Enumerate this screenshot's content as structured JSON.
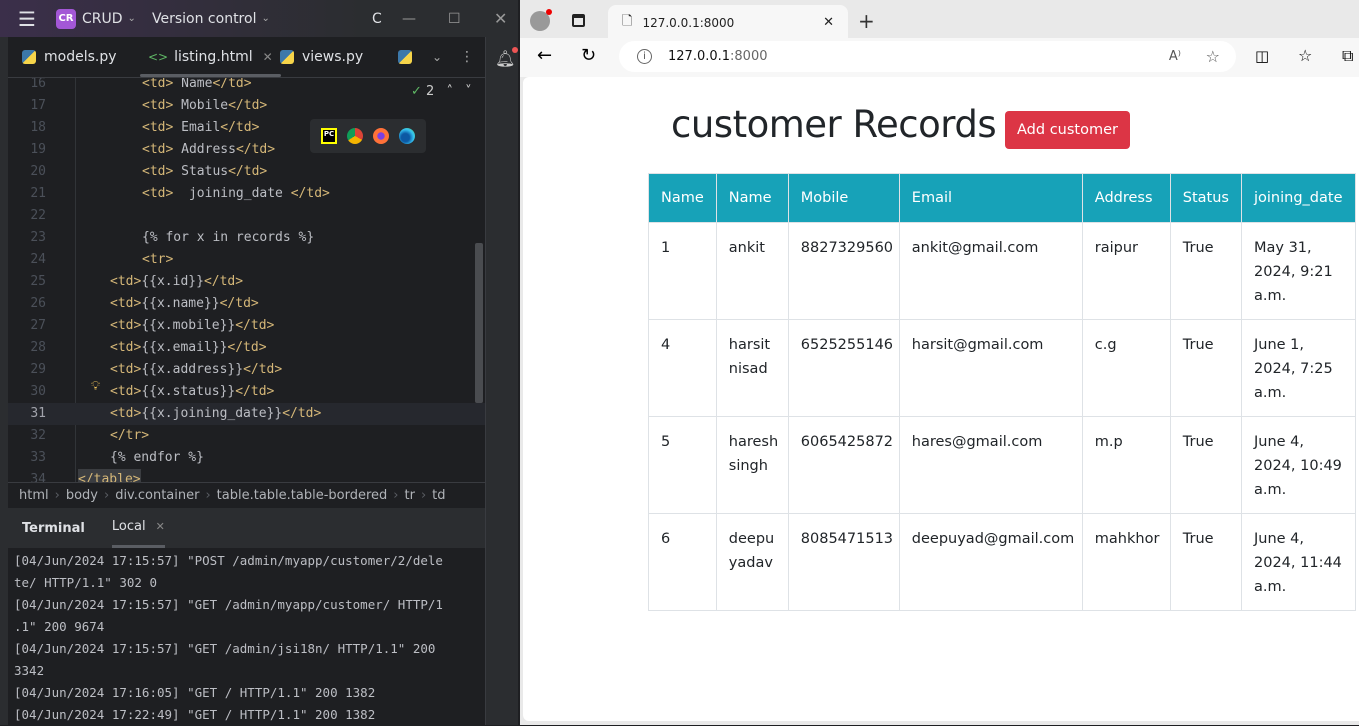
{
  "ide": {
    "project_initials": "CR",
    "project_name": "CRUD",
    "vcs_label": "Version control",
    "title_letter": "C",
    "tabs": [
      {
        "label": "models.py",
        "icon": "python-icon"
      },
      {
        "label": "listing.html",
        "icon": "html-icon",
        "active": true
      },
      {
        "label": "views.py",
        "icon": "python-icon"
      }
    ],
    "inspection_count": "2",
    "code_lines": [
      {
        "n": "16",
        "indent": 1,
        "text": "<td> Name</td>"
      },
      {
        "n": "17",
        "indent": 1,
        "text": "<td> Mobile</td>"
      },
      {
        "n": "18",
        "indent": 1,
        "text": "<td> Email</td>"
      },
      {
        "n": "19",
        "indent": 1,
        "text": "<td> Address</td>"
      },
      {
        "n": "20",
        "indent": 1,
        "text": "<td> Status</td>"
      },
      {
        "n": "21",
        "indent": 1,
        "text": "<td>  joining_date </td>"
      },
      {
        "n": "22",
        "indent": 1,
        "text": ""
      },
      {
        "n": "23",
        "indent": 1,
        "text": "{% for x in records %}"
      },
      {
        "n": "24",
        "indent": 1,
        "text": "<tr>"
      },
      {
        "n": "25",
        "indent": 0,
        "text": "<td>{{x.id}}</td>"
      },
      {
        "n": "26",
        "indent": 0,
        "text": "<td>{{x.name}}</td>"
      },
      {
        "n": "27",
        "indent": 0,
        "text": "<td>{{x.mobile}}</td>"
      },
      {
        "n": "28",
        "indent": 0,
        "text": "<td>{{x.email}}</td>"
      },
      {
        "n": "29",
        "indent": 0,
        "text": "<td>{{x.address}}</td>"
      },
      {
        "n": "30",
        "indent": 0,
        "text": "<td>{{x.status}}</td>"
      },
      {
        "n": "31",
        "indent": 0,
        "text": "<td>{{x.joining_date}}</td>",
        "current": true
      },
      {
        "n": "32",
        "indent": 0,
        "text": "</tr>"
      },
      {
        "n": "33",
        "indent": 0,
        "text": "{% endfor %}"
      },
      {
        "n": "34",
        "indent": -1,
        "text": "</table>"
      }
    ],
    "breadcrumbs": [
      "html",
      "body",
      "div.container",
      "table.table.table-bordered",
      "tr",
      "td"
    ],
    "terminal": {
      "title": "Terminal",
      "tab": "Local",
      "lines": [
        "[04/Jun/2024 17:15:57] \"POST /admin/myapp/customer/2/dele",
        "te/ HTTP/1.1\" 302 0",
        "[04/Jun/2024 17:15:57] \"GET /admin/myapp/customer/ HTTP/1",
        ".1\" 200 9674",
        "[04/Jun/2024 17:15:57] \"GET /admin/jsi18n/ HTTP/1.1\" 200",
        "3342",
        "[04/Jun/2024 17:16:05] \"GET / HTTP/1.1\" 200 1382",
        "[04/Jun/2024 17:22:49] \"GET / HTTP/1.1\" 200 1382"
      ]
    }
  },
  "browser": {
    "tab_title": "127.0.0.1:8000",
    "url_host": "127.0.0.1",
    "url_port": ":8000",
    "page": {
      "heading": "customer Records",
      "add_button": "Add customer",
      "header_color": "#17a2b8",
      "button_color": "#dc3545",
      "columns": [
        "Name",
        "Name",
        "Mobile",
        "Email",
        "Address",
        "Status",
        "joining_date"
      ],
      "rows": [
        [
          "1",
          "ankit",
          "8827329560",
          "ankit@gmail.com",
          "raipur",
          "True",
          "May 31, 2024, 9:21 a.m."
        ],
        [
          "4",
          "harsit nisad",
          "6525255146",
          "harsit@gmail.com",
          "c.g",
          "True",
          "June 1, 2024, 7:25 a.m."
        ],
        [
          "5",
          "haresh singh",
          "6065425872",
          "hares@gmail.com",
          "m.p",
          "True",
          "June 4, 2024, 10:49 a.m."
        ],
        [
          "6",
          "deepu yadav",
          "8085471513",
          "deepuyad@gmail.com",
          "mahkhor",
          "True",
          "June 4, 2024, 11:44 a.m."
        ]
      ]
    }
  }
}
